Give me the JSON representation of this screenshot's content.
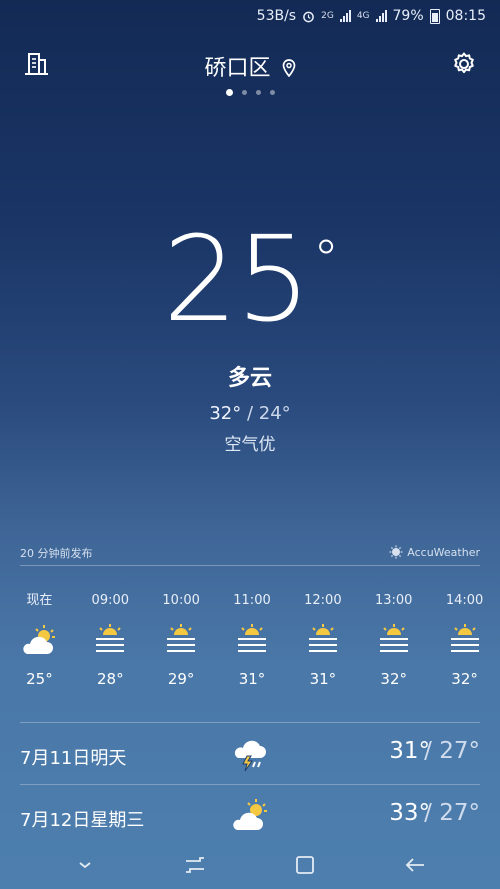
{
  "status": {
    "speed": "53B/s",
    "net1": "2G",
    "net2": "4G",
    "battery": "79%",
    "time": "08:15"
  },
  "header": {
    "location": "硚口区"
  },
  "current": {
    "temp": "25",
    "deg": "°",
    "condition": "多云",
    "high": "32°",
    "low": "24°",
    "range_sep": " / ",
    "air": "空气优"
  },
  "publish": {
    "text": "20 分钟前发布",
    "provider": "AccuWeather"
  },
  "hourly": [
    {
      "time": "现在",
      "icon": "partly-cloudy-icon",
      "temp": "25°"
    },
    {
      "time": "09:00",
      "icon": "haze-sun-icon",
      "temp": "28°"
    },
    {
      "time": "10:00",
      "icon": "haze-sun-icon",
      "temp": "29°"
    },
    {
      "time": "11:00",
      "icon": "haze-sun-icon",
      "temp": "31°"
    },
    {
      "time": "12:00",
      "icon": "haze-sun-icon",
      "temp": "31°"
    },
    {
      "time": "13:00",
      "icon": "haze-sun-icon",
      "temp": "32°"
    },
    {
      "time": "14:00",
      "icon": "haze-sun-icon",
      "temp": "32°"
    }
  ],
  "daily": [
    {
      "day": "7月11日明天",
      "icon": "thunderstorm-icon",
      "high": "31°",
      "low": "/ 27°"
    },
    {
      "day": "7月12日星期三",
      "icon": "partly-cloudy-icon",
      "high": "33°",
      "low": "/ 27°"
    }
  ]
}
